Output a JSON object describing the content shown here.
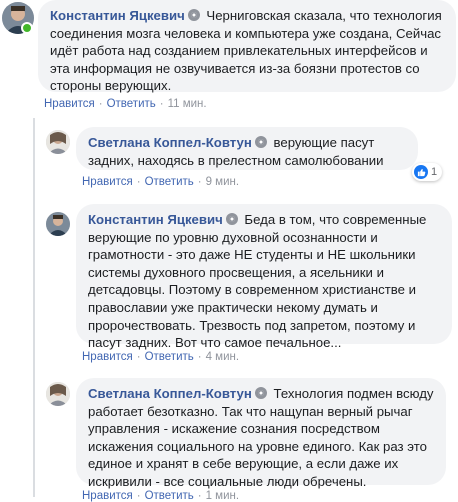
{
  "comments": [
    {
      "author": "Константин Яцкевич",
      "text": "Черниговская сказала, что технология соединения мозга человека и компьютера уже создана, Сейчас идёт работа над созданием привлекательных интерфейсов и эта информация не озвучивается из-за боязни протестов со стороны верующих.",
      "like_label": "Нравится",
      "reply_label": "Ответить",
      "time": "11 мин."
    },
    {
      "author": "Светлана Коппел-Ковтун",
      "text": "верующие пасут задних, находясь в прелестном самолюбовании",
      "like_label": "Нравится",
      "reply_label": "Ответить",
      "time": "9 мин.",
      "reaction_count": "1"
    },
    {
      "author": "Константин Яцкевич",
      "text": "Беда в том, что современные верующие по уровню духовной осознанности и грамотности - это даже НЕ студенты и НЕ школьники системы духовного просвещения, а ясельники и детсадовцы. Поэтому в современном христианстве и православии уже практически некому думать и пророчествовать. Трезвость под запретом, поэтому и пасут задних. Вот что самое печальное...",
      "like_label": "Нравится",
      "reply_label": "Ответить",
      "time": "4 мин."
    },
    {
      "author": "Светлана Коппел-Ковтун",
      "text": "Технология подмен всюду работает безотказно. Так что нащупан верный рычаг управления - искажение сознания посредством искажения социального на уровне единого. Как раз это единое и хранят в себе верующие, а если даже их искривили - все социальные люди обречены.",
      "like_label": "Нравится",
      "reply_label": "Ответить",
      "time": "1 мин."
    }
  ],
  "colors": {
    "author": "#385898",
    "link": "#4267b2",
    "meta": "#90949c",
    "bubble": "#f2f3f5",
    "online": "#42b72a",
    "like": "#1877f2"
  },
  "icons": [
    "verified-badge-icon",
    "like-reaction-icon"
  ]
}
